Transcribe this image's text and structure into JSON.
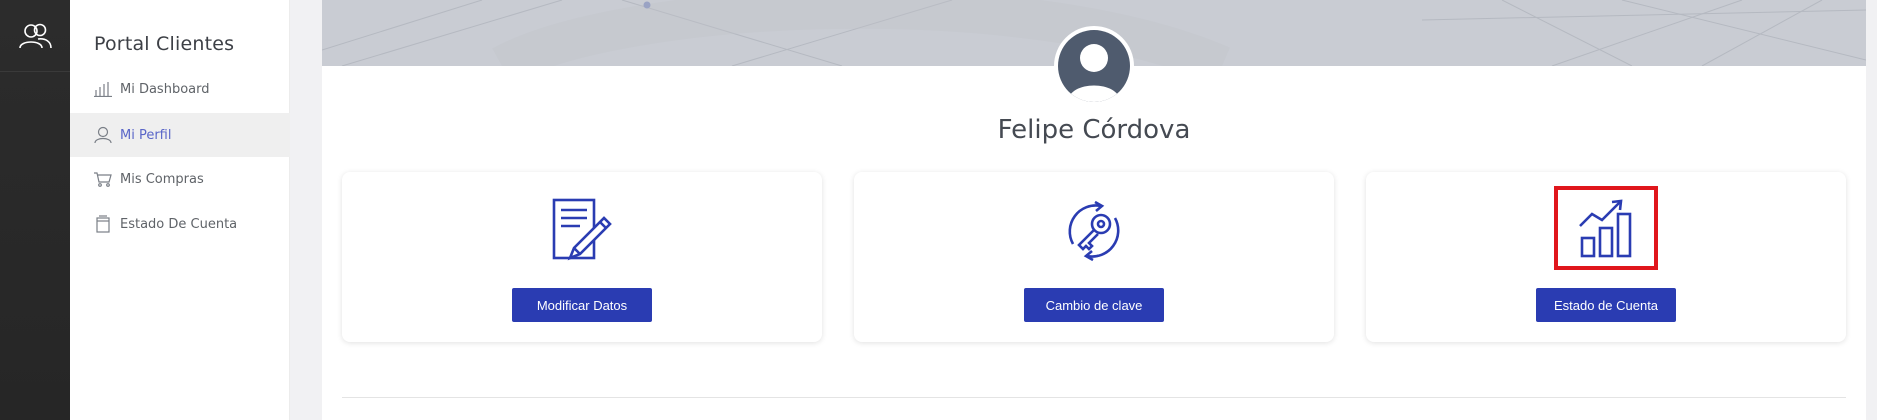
{
  "sidebar": {
    "brand": "Portal Clientes",
    "items": [
      {
        "label": "Mi Dashboard",
        "icon": "bar-chart-icon"
      },
      {
        "label": "Mi Perfil",
        "icon": "user-icon",
        "active": true
      },
      {
        "label": "Mis Compras",
        "icon": "cart-icon"
      },
      {
        "label": "Estado De Cuenta",
        "icon": "document-icon"
      }
    ]
  },
  "profile": {
    "name": "Felipe Córdova"
  },
  "cards": [
    {
      "button": "Modificar Datos",
      "icon": "edit-document-icon"
    },
    {
      "button": "Cambio de clave",
      "icon": "key-refresh-icon"
    },
    {
      "button": "Estado de Cuenta",
      "icon": "growth-chart-icon",
      "highlighted": true
    }
  ],
  "colors": {
    "primary": "#2a3cb2",
    "highlight": "#e0161c",
    "rail": "#2c2c2c"
  }
}
